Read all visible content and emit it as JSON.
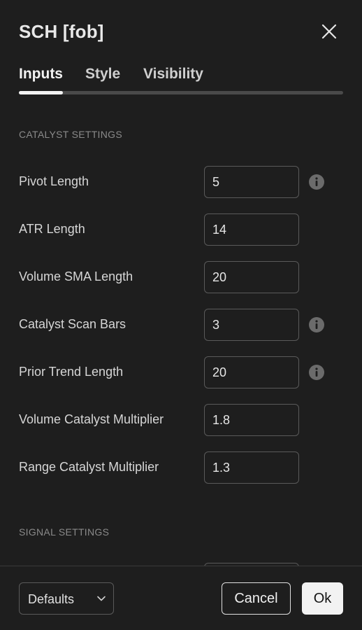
{
  "dialog": {
    "title": "SCH [fob]",
    "close_icon": "close-icon"
  },
  "tabs": [
    {
      "label": "Inputs",
      "active": true
    },
    {
      "label": "Style",
      "active": false
    },
    {
      "label": "Visibility",
      "active": false
    }
  ],
  "sections": {
    "catalyst": {
      "title": "CATALYST SETTINGS",
      "rows": [
        {
          "label": "Pivot Length",
          "value": "5",
          "info": true
        },
        {
          "label": "ATR Length",
          "value": "14",
          "info": false
        },
        {
          "label": "Volume SMA Length",
          "value": "20",
          "info": false
        },
        {
          "label": "Catalyst Scan Bars",
          "value": "3",
          "info": true
        },
        {
          "label": "Prior Trend Length",
          "value": "20",
          "info": true
        },
        {
          "label": "Volume Catalyst Multiplier",
          "value": "1.8",
          "info": false
        },
        {
          "label": "Range Catalyst Multiplier",
          "value": "1.3",
          "info": false
        }
      ]
    },
    "signal": {
      "title": "SIGNAL SETTINGS"
    }
  },
  "footer": {
    "defaults_label": "Defaults",
    "cancel_label": "Cancel",
    "ok_label": "Ok"
  },
  "colors": {
    "background": "#1e1e1e",
    "text": "#dbdbdb",
    "muted": "#8a8a8a",
    "border": "#5a5a5a",
    "accent": "#f2f2f2"
  }
}
